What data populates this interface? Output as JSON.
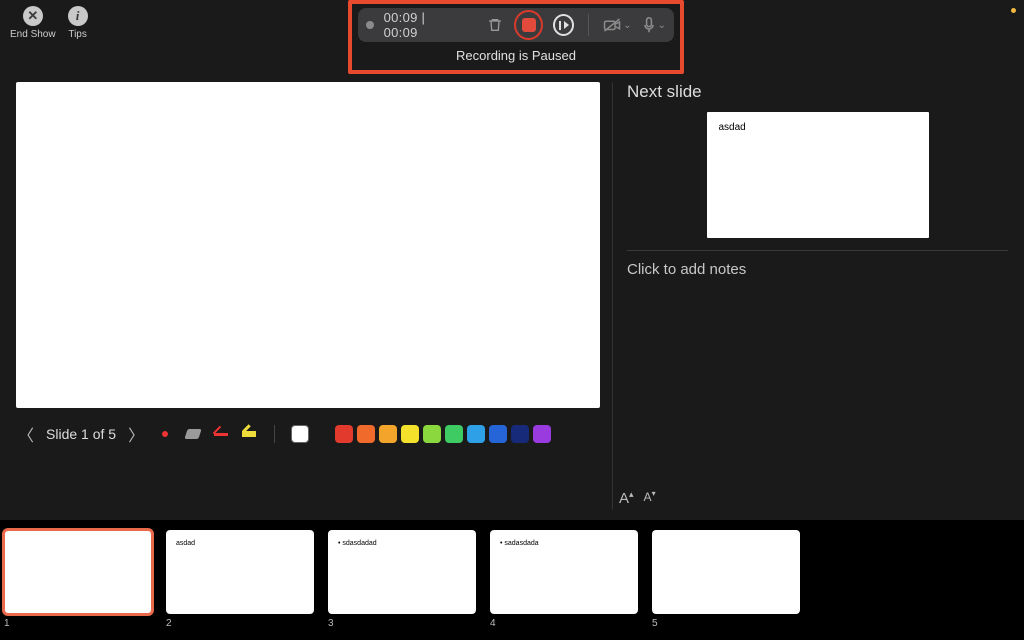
{
  "topButtons": {
    "endShow": {
      "symbol": "✕",
      "label": "End Show"
    },
    "tips": {
      "symbol": "i",
      "label": "Tips"
    }
  },
  "recording": {
    "timeElapsed": "00:09",
    "timeTotal": "00:09",
    "timeDisplay": "00:09 | 00:09",
    "statusText": "Recording is Paused"
  },
  "slideNav": {
    "label": "Slide 1 of 5",
    "currentIndex": 1,
    "total": 5
  },
  "palette": {
    "colors": [
      "#ffffff",
      "#1a1a1a",
      "#e23b2e",
      "#f06a2b",
      "#f3a52b",
      "#f3e12b",
      "#8bd83e",
      "#3ecb63",
      "#2ea0e8",
      "#2565d8",
      "#172a7a",
      "#9a3be0"
    ]
  },
  "nextSlide": {
    "title": "Next slide",
    "contentText": "asdad"
  },
  "notes": {
    "placeholder": "Click to add notes"
  },
  "fontControls": {
    "increase": "Â",
    "decrease": "Ǎ"
  },
  "thumbnails": [
    {
      "num": "1",
      "text": "",
      "selected": true
    },
    {
      "num": "2",
      "text": "asdad",
      "selected": false
    },
    {
      "num": "3",
      "text": "• sdasdadad",
      "selected": false
    },
    {
      "num": "4",
      "text": "• sadasdada",
      "selected": false
    },
    {
      "num": "5",
      "text": "",
      "selected": false
    }
  ]
}
